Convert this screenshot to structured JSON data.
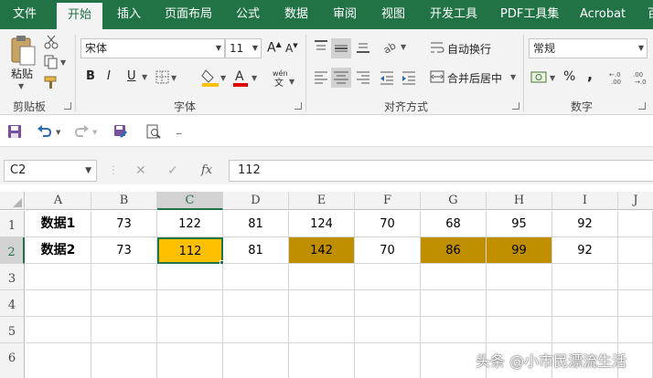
{
  "ribbon_tabs": [
    "文件",
    "开始",
    "插入",
    "页面布局",
    "公式",
    "数据",
    "审阅",
    "视图",
    "开发工具",
    "PDF工具集",
    "Acrobat",
    "百"
  ],
  "active_tab_index": 1,
  "clipboard": {
    "paste_label": "粘贴",
    "group_label": "剪贴板"
  },
  "font": {
    "name": "宋体",
    "size": "11",
    "group_label": "字体",
    "phonetic_icon": "wén",
    "buttons": [
      "B",
      "I",
      "U"
    ]
  },
  "alignment": {
    "wrap_label": "自动换行",
    "merge_label": "合并后居中",
    "group_label": "对齐方式"
  },
  "number": {
    "format": "常规",
    "percent": "%",
    "comma": ",",
    "group_label": "数字"
  },
  "formula_bar": {
    "name_box": "C2",
    "content": "112",
    "fx": "fx",
    "cancel": "✕",
    "enter": "✓"
  },
  "columns": [
    "A",
    "B",
    "C",
    "D",
    "E",
    "F",
    "G",
    "H",
    "I",
    "J"
  ],
  "rows": [
    "1",
    "2",
    "3",
    "4",
    "5",
    "6"
  ],
  "sheet": {
    "row1": [
      "数据1",
      "73",
      "122",
      "81",
      "124",
      "70",
      "68",
      "95",
      "92"
    ],
    "row2": [
      "数据2",
      "73",
      "112",
      "81",
      "142",
      "70",
      "86",
      "99",
      "92"
    ]
  },
  "selected_cell": "C2",
  "colors": {
    "brand_green": "#217346",
    "selected_fill": "#FFC000",
    "highlight_fill": "#BF8F00"
  },
  "highlighted_cells": [
    "C2",
    "E2",
    "G2",
    "H2"
  ],
  "watermark": "头条 @小市民漂流生活"
}
